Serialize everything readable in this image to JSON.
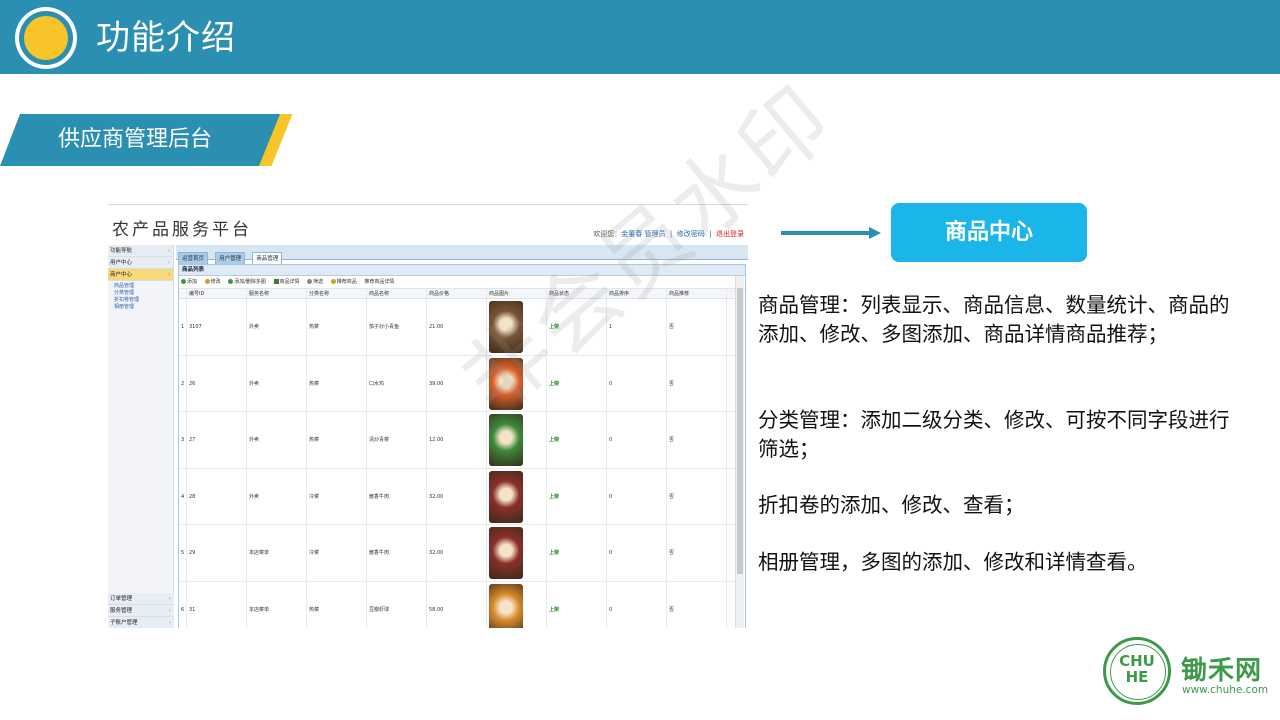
{
  "header": {
    "title": "功能介绍"
  },
  "section": {
    "label": "供应商管理后台"
  },
  "screenshot": {
    "app_title": "农产品服务平台",
    "topright": {
      "welcome": "欢迎您：",
      "user": "金董春 管理员",
      "change_pwd": "修改密码",
      "logout": "退出登录"
    },
    "sidebar": {
      "groups": [
        {
          "label": "功能导航"
        },
        {
          "label": "用户中心"
        },
        {
          "label": "商户中心",
          "active": true
        }
      ],
      "subitems": [
        "商品管理",
        "分类管理",
        "折扣卷管理",
        "相册管理"
      ],
      "bottom_groups": [
        "订单管理",
        "服务管理",
        "子账户管理"
      ]
    },
    "tabs": [
      {
        "label": "运营首页"
      },
      {
        "label": "用户管理"
      },
      {
        "label": "商品管理",
        "active": true
      }
    ],
    "panel_title": "商品列表",
    "toolbar": [
      "添加",
      "修改",
      "添加/删除多图",
      "商品详情",
      "筛选",
      "推荐商品",
      "推荐商品详情"
    ],
    "columns": [
      "编号ID",
      "服务名称",
      "分类名称",
      "商品名称",
      "商品价格",
      "商品图片",
      "商品状态",
      "商品排序",
      "商品推荐"
    ],
    "rows": [
      {
        "n": "1",
        "id": "3107",
        "service": "外卖",
        "category": "热菜",
        "name": "茄子炒小青鱼",
        "price": "21.00",
        "status": "上架",
        "order": "1",
        "rec": "否",
        "img": "#7a5535"
      },
      {
        "n": "2",
        "id": "26",
        "service": "外卖",
        "category": "热菜",
        "name": "口水鸡",
        "price": "39.00",
        "status": "上架",
        "order": "0",
        "rec": "否",
        "img": "#d9622b"
      },
      {
        "n": "3",
        "id": "27",
        "service": "外卖",
        "category": "热菜",
        "name": "清炒青菜",
        "price": "12.00",
        "status": "上架",
        "order": "0",
        "rec": "否",
        "img": "#3c8a3a"
      },
      {
        "n": "4",
        "id": "28",
        "service": "外卖",
        "category": "冷菜",
        "name": "酱香牛肉",
        "price": "32.00",
        "status": "上架",
        "order": "0",
        "rec": "否",
        "img": "#8a2f2a"
      },
      {
        "n": "5",
        "id": "29",
        "service": "本店菜单",
        "category": "冷菜",
        "name": "酱香牛肉",
        "price": "32.00",
        "status": "上架",
        "order": "0",
        "rec": "否",
        "img": "#8a2f2a"
      },
      {
        "n": "6",
        "id": "31",
        "service": "本店菜单",
        "category": "热菜",
        "name": "豆瓣虾球",
        "price": "58.00",
        "status": "上架",
        "order": "0",
        "rec": "否",
        "img": "#d9892b"
      }
    ],
    "watermark": "非会员水印"
  },
  "center_button": {
    "label": "商品中心"
  },
  "descriptions": [
    "商品管理：列表显示、商品信息、数量统计、商品的添加、修改、多图添加、商品详情商品推荐；",
    "分类管理：添加二级分类、修改、可按不同字段进行筛选；",
    "折扣卷的添加、修改、查看；",
    "相册管理，多图的添加、修改和详情查看。"
  ],
  "brand": {
    "logo_text": "CHU HE",
    "name": "锄禾网",
    "url": "www.chuhe.com"
  },
  "colors": {
    "header": "#2a8fb0",
    "accent_yellow": "#f7c52a",
    "button": "#1ab6e9",
    "brand_green": "#3d9a4a"
  }
}
